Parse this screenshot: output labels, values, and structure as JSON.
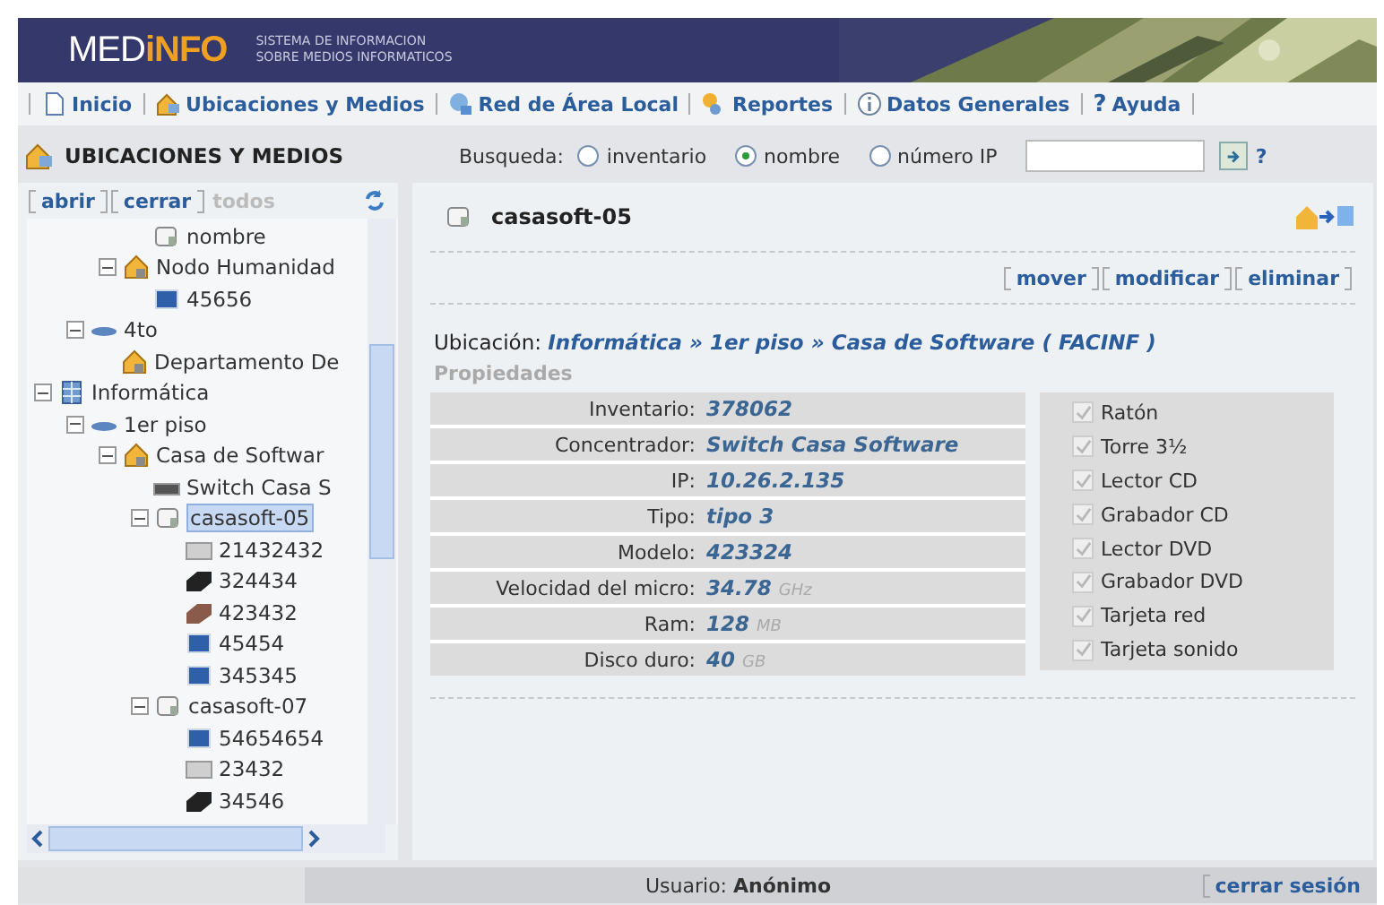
{
  "header": {
    "logo_main": "MED",
    "logo_accent": "iNFO",
    "subtitle": [
      "SISTEMA DE INFORMACION",
      "SOBRE MEDIOS INFORMATICOS"
    ]
  },
  "nav": [
    {
      "label": "Inicio",
      "kind": "page"
    },
    {
      "label": "Ubicaciones y Medios",
      "kind": "locations"
    },
    {
      "label": "Red de Área Local",
      "kind": "network"
    },
    {
      "label": "Reportes",
      "kind": "reports"
    },
    {
      "label": "Datos Generales",
      "kind": "info"
    },
    {
      "label": "Ayuda",
      "kind": "help",
      "symbol": "?"
    }
  ],
  "section": {
    "title": "UBICACIONES Y MEDIOS"
  },
  "search": {
    "label": "Busqueda:",
    "options": [
      {
        "label": "inventario",
        "selected": false
      },
      {
        "label": "nombre",
        "selected": true
      },
      {
        "label": "número IP",
        "selected": false
      }
    ],
    "help_symbol": "?"
  },
  "tree_toolbar": [
    {
      "label": "abrir",
      "disabled": false
    },
    {
      "label": "cerrar",
      "disabled": false
    },
    {
      "label": "todos",
      "disabled": true
    }
  ],
  "tree": {
    "items": [
      {
        "children": [
          {
            "children": [
              {
                "children": [
                  {
                    "label": "nombre",
                    "kind": "pc",
                    "selected": false
                  }
                ]
              },
              {
                "label": "Nodo Humanidad",
                "kind": "node",
                "expanded": true,
                "selected": false,
                "children": [
                  {
                    "label": "45656",
                    "kind": "monitor",
                    "selected": false
                  }
                ]
              }
            ]
          },
          {
            "label": "4to",
            "kind": "floor",
            "expanded": true,
            "selected": false,
            "children": [
              {
                "label": "Departamento De",
                "kind": "node",
                "selected": false
              }
            ]
          }
        ]
      },
      {
        "label": "Informática",
        "kind": "building",
        "expanded": true,
        "selected": false,
        "children": [
          {
            "label": "1er piso",
            "kind": "floor",
            "expanded": true,
            "selected": false,
            "children": [
              {
                "label": "Casa de Softwar",
                "kind": "node",
                "expanded": true,
                "selected": false,
                "children": [
                  {
                    "label": "Switch Casa S",
                    "kind": "switch",
                    "selected": false
                  },
                  {
                    "label": "casasoft-05",
                    "kind": "pc",
                    "expanded": true,
                    "selected": true,
                    "children": [
                      {
                        "label": "21432432",
                        "kind": "modem",
                        "selected": false
                      },
                      {
                        "label": "324434",
                        "kind": "drive",
                        "selected": false
                      },
                      {
                        "label": "423432",
                        "kind": "disk",
                        "selected": false
                      },
                      {
                        "label": "45454",
                        "kind": "card",
                        "selected": false
                      },
                      {
                        "label": "345345",
                        "kind": "card",
                        "selected": false
                      }
                    ]
                  },
                  {
                    "label": "casasoft-07",
                    "kind": "pc",
                    "expanded": true,
                    "selected": false,
                    "children": [
                      {
                        "label": "54654654",
                        "kind": "monitor",
                        "selected": false
                      },
                      {
                        "label": "23432",
                        "kind": "modem",
                        "selected": false
                      },
                      {
                        "label": "34546",
                        "kind": "drive",
                        "selected": false
                      }
                    ]
                  }
                ]
              }
            ]
          }
        ]
      }
    ]
  },
  "detail": {
    "title": "casasoft-05",
    "actions": [
      "mover",
      "modificar",
      "eliminar"
    ],
    "location_label": "Ubicación:",
    "location": "Informática » 1er piso » Casa de Software ( FACINF )",
    "properties_heading": "Propiedades",
    "properties": [
      {
        "label": "Inventario:",
        "value": "378062"
      },
      {
        "label": "Concentrador:",
        "value": "Switch Casa Software"
      },
      {
        "label": "IP:",
        "value": "10.26.2.135"
      },
      {
        "label": "Tipo:",
        "value": "tipo 3"
      },
      {
        "label": "Modelo:",
        "value": "423324"
      },
      {
        "label": "Velocidad del micro:",
        "value": "34.78",
        "unit": "GHz"
      },
      {
        "label": "Ram:",
        "value": "128",
        "unit": "MB"
      },
      {
        "label": "Disco duro:",
        "value": "40",
        "unit": "GB"
      }
    ],
    "features": [
      {
        "label": "Ratón",
        "checked": true
      },
      {
        "label": "Torre 3½",
        "checked": true
      },
      {
        "label": "Lector CD",
        "checked": true
      },
      {
        "label": "Grabador CD",
        "checked": true
      },
      {
        "label": "Lector DVD",
        "checked": true
      },
      {
        "label": "Grabador DVD",
        "checked": true
      },
      {
        "label": "Tarjeta red",
        "checked": true
      },
      {
        "label": "Tarjeta sonido",
        "checked": true
      }
    ]
  },
  "status_bar": {
    "user": "Usuario: **Anónimo**",
    "logout": "cerrar sesión"
  }
}
